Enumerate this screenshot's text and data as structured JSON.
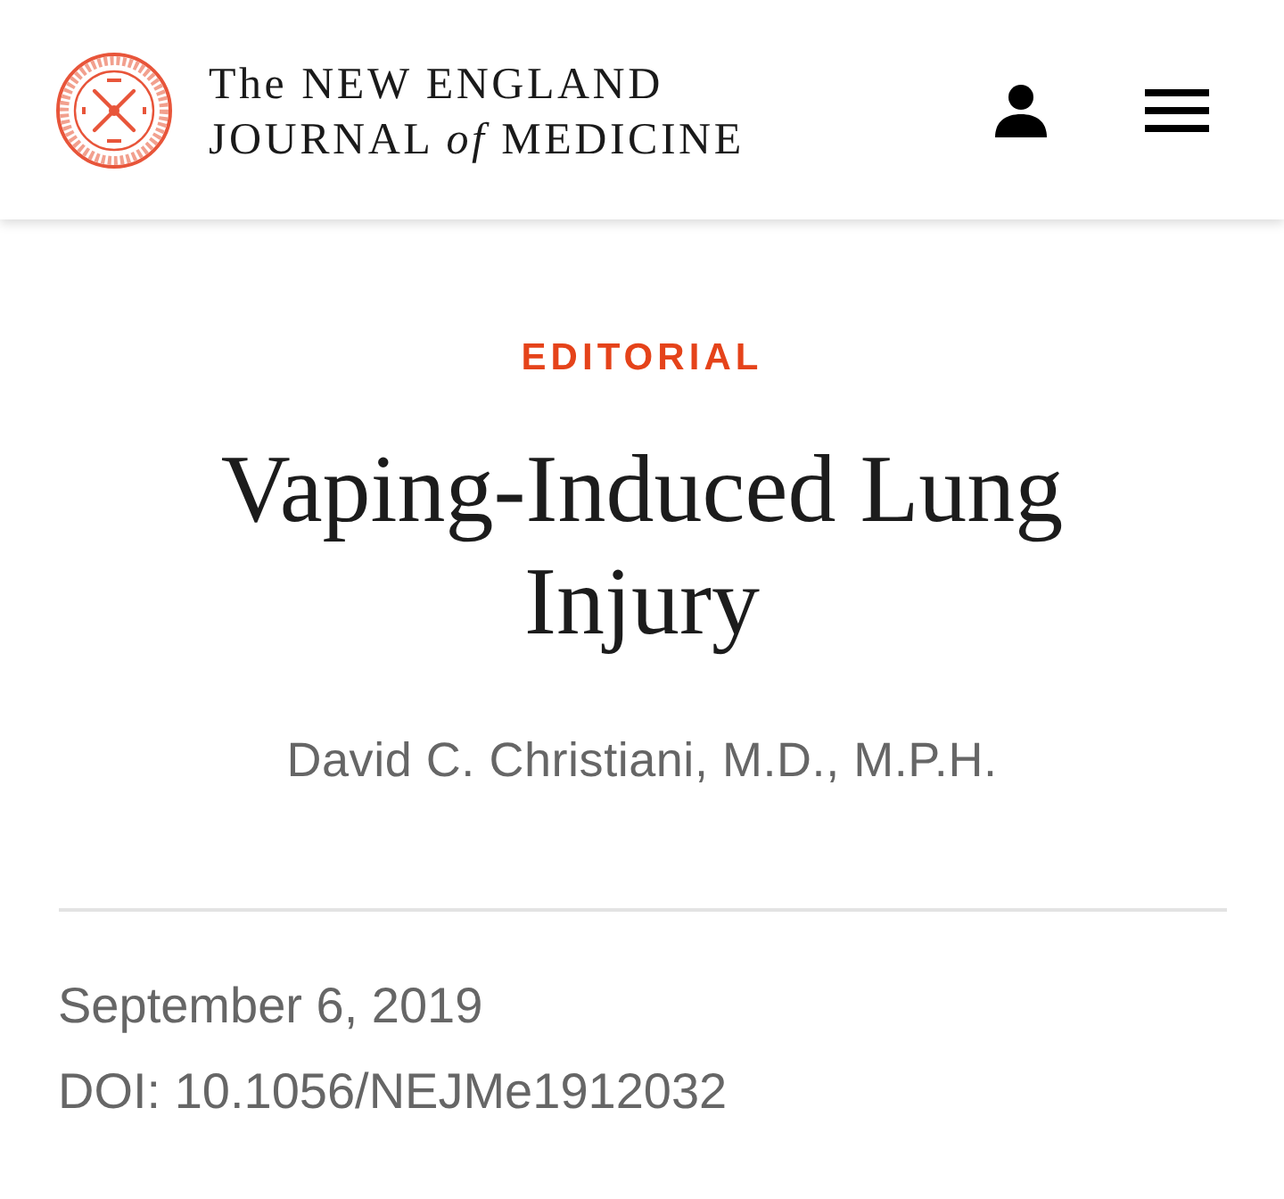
{
  "header": {
    "logo": {
      "line_1": "The NEW ENGLAND",
      "line_2": "JOURNAL *of* MEDICINE"
    }
  },
  "article": {
    "category": "EDITORIAL",
    "title": "Vaping-Induced Lung Injury",
    "author": "David C. Christiani, M.D., M.P.H.",
    "date": "September 6, 2019",
    "doi": "DOI: 10.1056/NEJMe1912032"
  }
}
